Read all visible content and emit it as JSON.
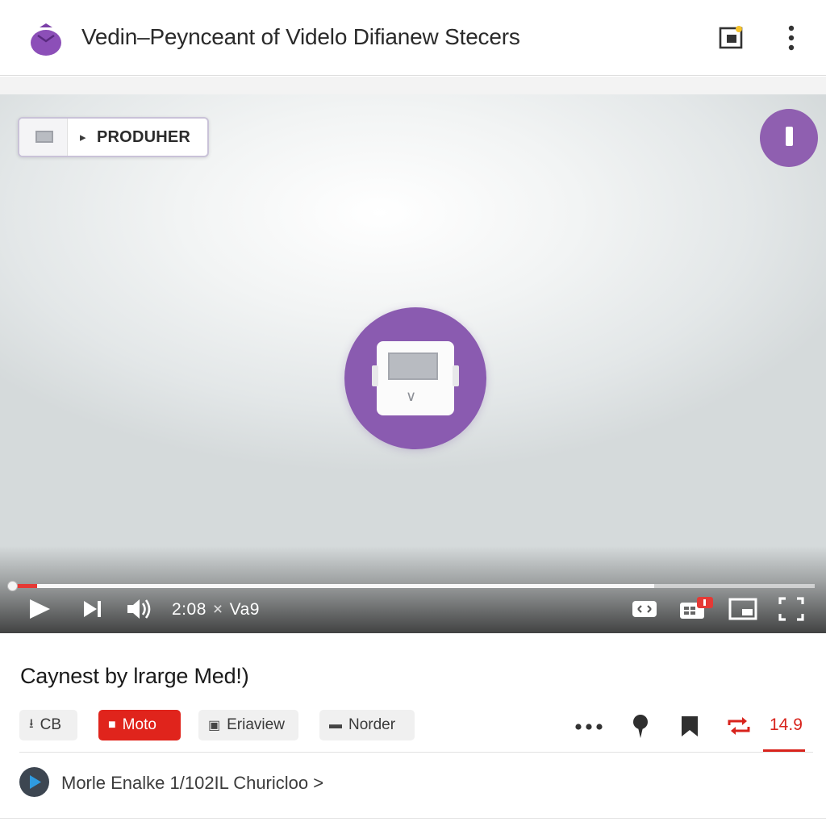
{
  "header": {
    "title": "Vedin–Peyncеant of Videlo Difianew Stecers",
    "icons": {
      "logo": "purple-bag-logo-icon",
      "share": "share-icon",
      "more": "more-vertical-icon"
    }
  },
  "player": {
    "producer_label": "PRODUHER",
    "producer_arrow": "▸",
    "corner_badge_icon": "info-badge-icon",
    "center_button_icon": "video-card-icon",
    "progress": {
      "played": 0.03,
      "buffered": 0.8
    },
    "time": {
      "current": "2:08",
      "separator": "×",
      "total": "Va9"
    },
    "controls": [
      "play-icon",
      "next-icon",
      "volume-icon",
      "captions-icon",
      "settings-icon",
      "miniplayer-icon",
      "fullscreen-icon"
    ],
    "accent": "#e53935",
    "brand_color": "#8a5bb0"
  },
  "info": {
    "video_title": "Caynest by lrarge Med!)",
    "chips": {
      "cb": {
        "icon": "⭳",
        "label": "CB"
      },
      "moto": {
        "icon": "■",
        "label": "Moto"
      },
      "erawiew": {
        "icon": "▣",
        "label": "Eriaview"
      },
      "norder": {
        "icon": "▬",
        "label": "Norder"
      }
    },
    "count": "14.9",
    "more_link": "Morle Enalke 1/102IL Churicloo >"
  }
}
